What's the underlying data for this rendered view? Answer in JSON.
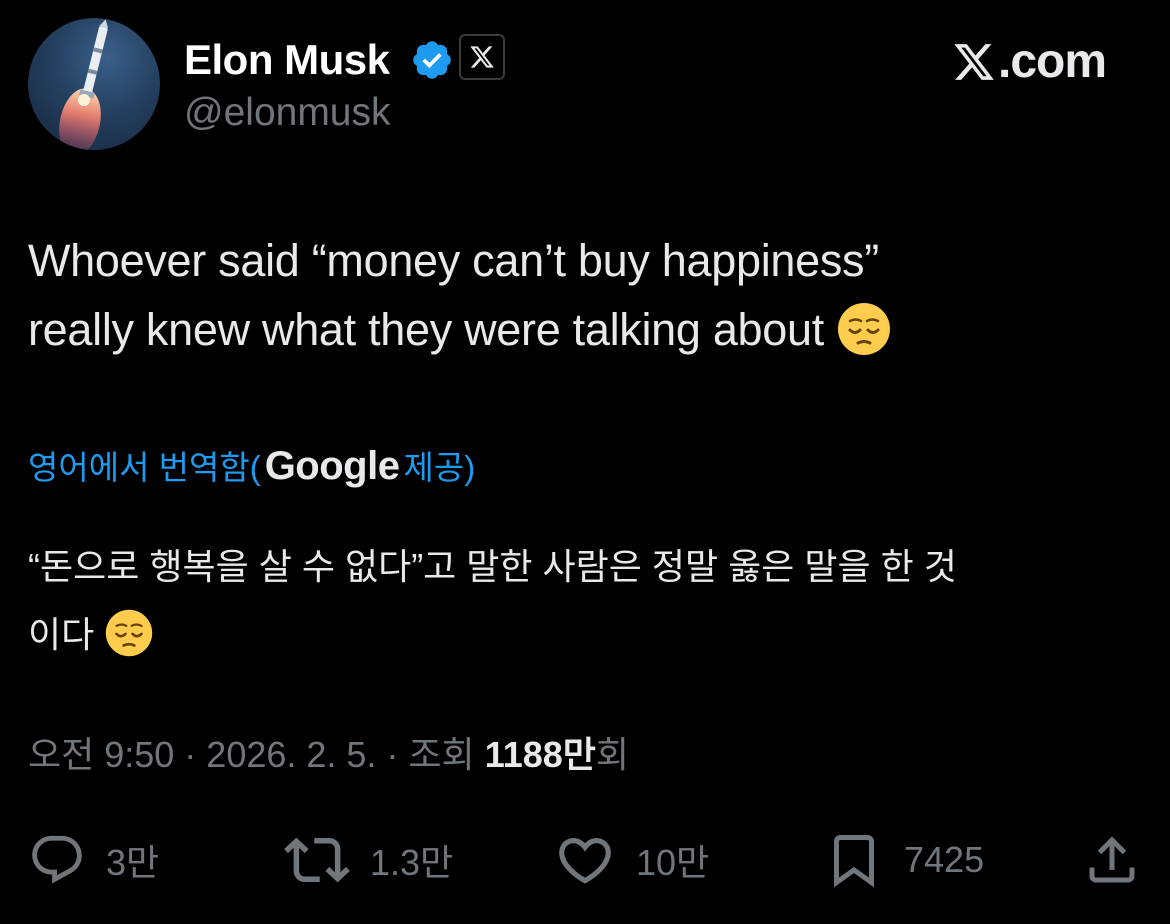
{
  "author": {
    "display_name": "Elon Musk",
    "handle": "@elonmusk",
    "verified_icon": "verified-badge-icon",
    "affiliation_icon": "x-logo-icon"
  },
  "brand": {
    "label": ".com",
    "logo_icon": "x-logo-icon"
  },
  "tweet": {
    "line_1": "Whoever said “money can’t buy happiness”",
    "line_2": "really knew what they were talking about",
    "emoji": "pensive-face"
  },
  "translation": {
    "prefix": "영어에서 번역함(",
    "provider": "Google",
    "suffix": "제공)",
    "line_1": "“돈으로 행복을 살 수 없다”고 말한 사람은 정말 옳은 말을 한 것",
    "line_2": "이다",
    "emoji": "pensive-face"
  },
  "meta": {
    "prefix": "오전 9:50 · 2026. 2. 5. · 조회 ",
    "views_count": "1188만",
    "views_suffix": "회"
  },
  "actions": {
    "reply_count": "3만",
    "repost_count": "1.3만",
    "like_count": "10만",
    "bookmark_count": "7425"
  },
  "colors": {
    "background": "#000000",
    "text": "#e7e9ea",
    "secondary_text": "#71767b",
    "accent": "#1d9bf0"
  }
}
